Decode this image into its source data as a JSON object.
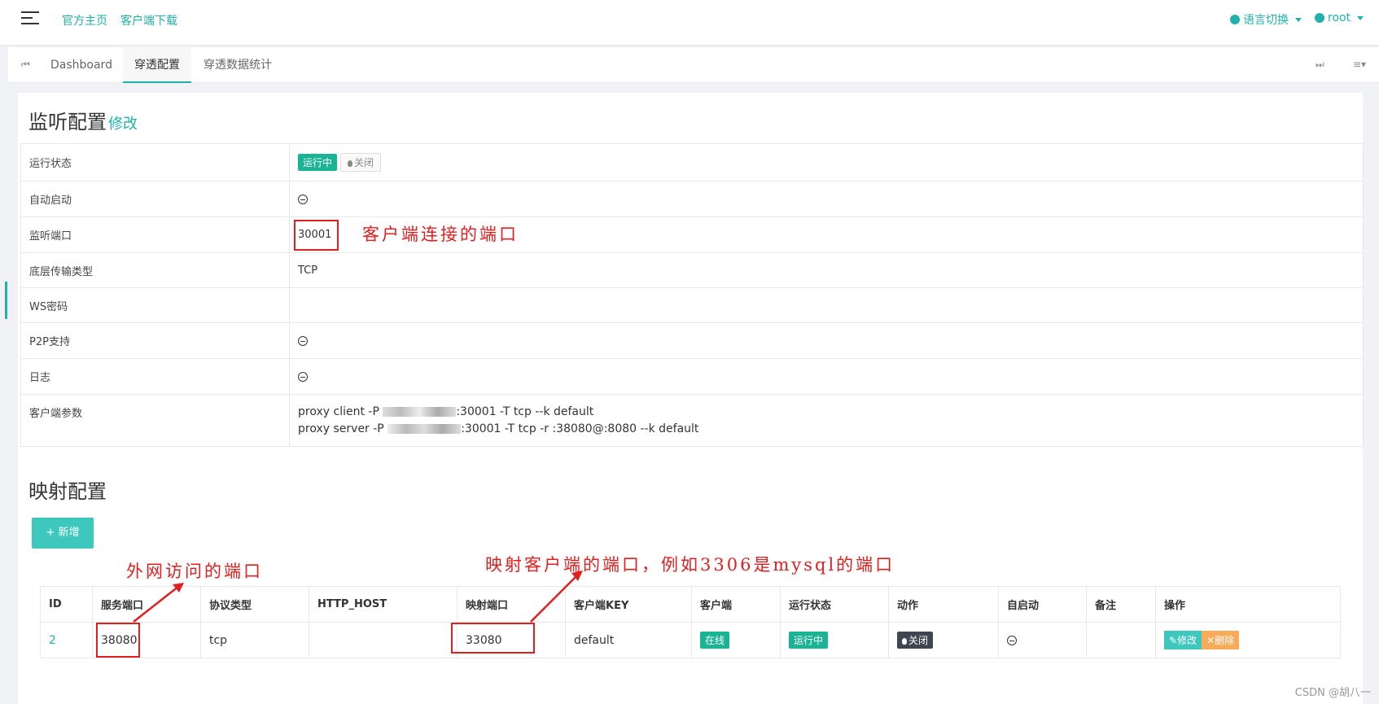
{
  "topbar": {
    "links": [
      "官方主页",
      "客户端下载"
    ],
    "lang_label": "语言切换",
    "user_label": "root"
  },
  "tabs": [
    "Dashboard",
    "穿透配置",
    "穿透数据统计"
  ],
  "listen": {
    "title": "监听配置",
    "edit": "修改",
    "rows": {
      "status_label": "运行状态",
      "status_value": "运行中",
      "status_off": "关闭",
      "autostart_label": "自动启动",
      "port_label": "监听端口",
      "port_value": "30001",
      "transport_label": "底层传输类型",
      "transport_value": "TCP",
      "ws_label": "WS密码",
      "p2p_label": "P2P支持",
      "log_label": "日志",
      "params_label": "客户端参数",
      "param_client_a": "proxy client -P ",
      "param_client_b": ":30001 -T tcp --k default",
      "param_server_a": "proxy server -P ",
      "param_server_b": ":30001 -T tcp -r :38080@:8080 --k default"
    }
  },
  "mapping": {
    "title": "映射配置",
    "add": "+ 新增",
    "headers": [
      "ID",
      "服务端口",
      "协议类型",
      "HTTP_HOST",
      "映射端口",
      "客户端KEY",
      "客户端",
      "运行状态",
      "动作",
      "自启动",
      "备注",
      "操作"
    ],
    "row": {
      "id": "2",
      "service_port": "38080",
      "protocol": "tcp",
      "http_host": "",
      "map_port": "33080",
      "client_key": "default",
      "client": "在线",
      "run_status": "运行中",
      "action": "关闭",
      "edit": "修改",
      "delete": "删除"
    }
  },
  "annotations": {
    "listen_port": "客户端连接的端口",
    "external_port": "外网访问的端口",
    "mapped_port": "映射客户端的端口，例如3306是mysql的端口"
  },
  "watermark": "CSDN @胡八一"
}
